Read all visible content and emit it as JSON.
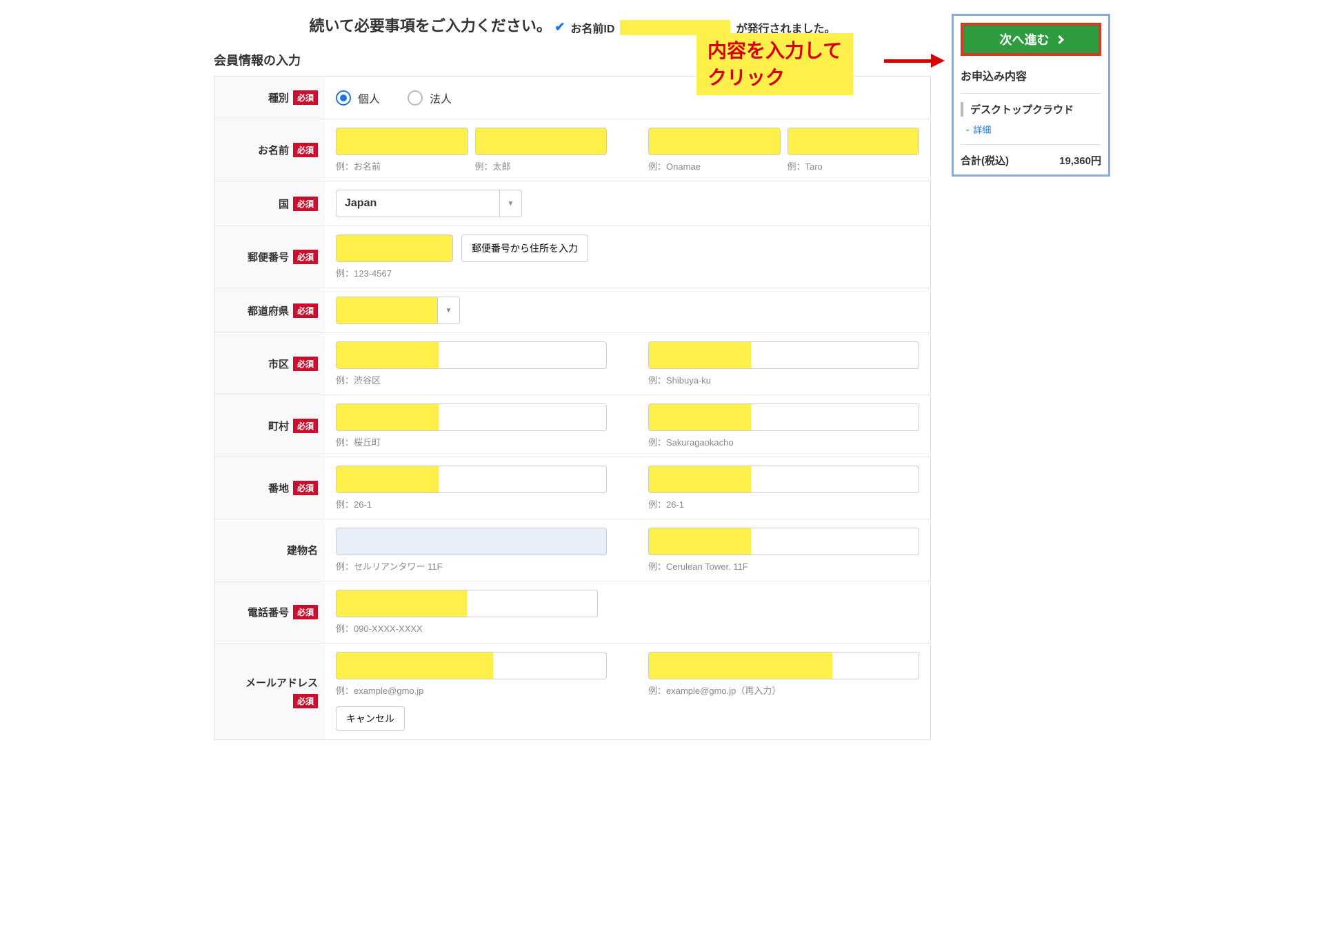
{
  "header": {
    "instruction": "続いて必要事項をご入力ください。",
    "issued_prefix_label": "お名前ID",
    "issued_suffix": "が発行されました。"
  },
  "callout": {
    "text": "内容を入力して\nクリック"
  },
  "section": {
    "title": "会員情報の入力",
    "required_badge": "必須"
  },
  "form": {
    "type": {
      "label": "種別",
      "options": {
        "individual": "個人",
        "corporate": "法人"
      },
      "selected": "individual"
    },
    "name": {
      "label": "お名前",
      "hints": {
        "sei": "例：お名前",
        "mei": "例：太郎",
        "sei_en": "例：Onamae",
        "mei_en": "例：Taro"
      }
    },
    "country": {
      "label": "国",
      "value": "Japan"
    },
    "postal": {
      "label": "郵便番号",
      "autofill_button": "郵便番号から住所を入力",
      "hint": "例：123-4567"
    },
    "prefecture": {
      "label": "都道府県"
    },
    "city": {
      "label": "市区",
      "hint_ja": "例：渋谷区",
      "hint_en": "例：Shibuya-ku"
    },
    "town": {
      "label": "町村",
      "hint_ja": "例：桜丘町",
      "hint_en": "例：Sakuragaokacho"
    },
    "address": {
      "label": "番地",
      "hint_ja": "例：26-1",
      "hint_en": "例：26-1"
    },
    "building": {
      "label": "建物名",
      "hint_ja": "例：セルリアンタワー 11F",
      "hint_en": "例：Cerulean Tower. 11F"
    },
    "phone": {
      "label": "電話番号",
      "hint": "例：090-XXXX-XXXX"
    },
    "email": {
      "label": "メールアドレス",
      "hint": "例：example@gmo.jp",
      "hint_confirm": "例：example@gmo.jp（再入力）",
      "cancel_button": "キャンセル"
    }
  },
  "sidebar": {
    "next_button": "次へ進む",
    "title": "お申込み内容",
    "item_title": "デスクトップクラウド",
    "detail_link": "詳細",
    "total_label": "合計(税込)",
    "total_value": "19,360円"
  }
}
